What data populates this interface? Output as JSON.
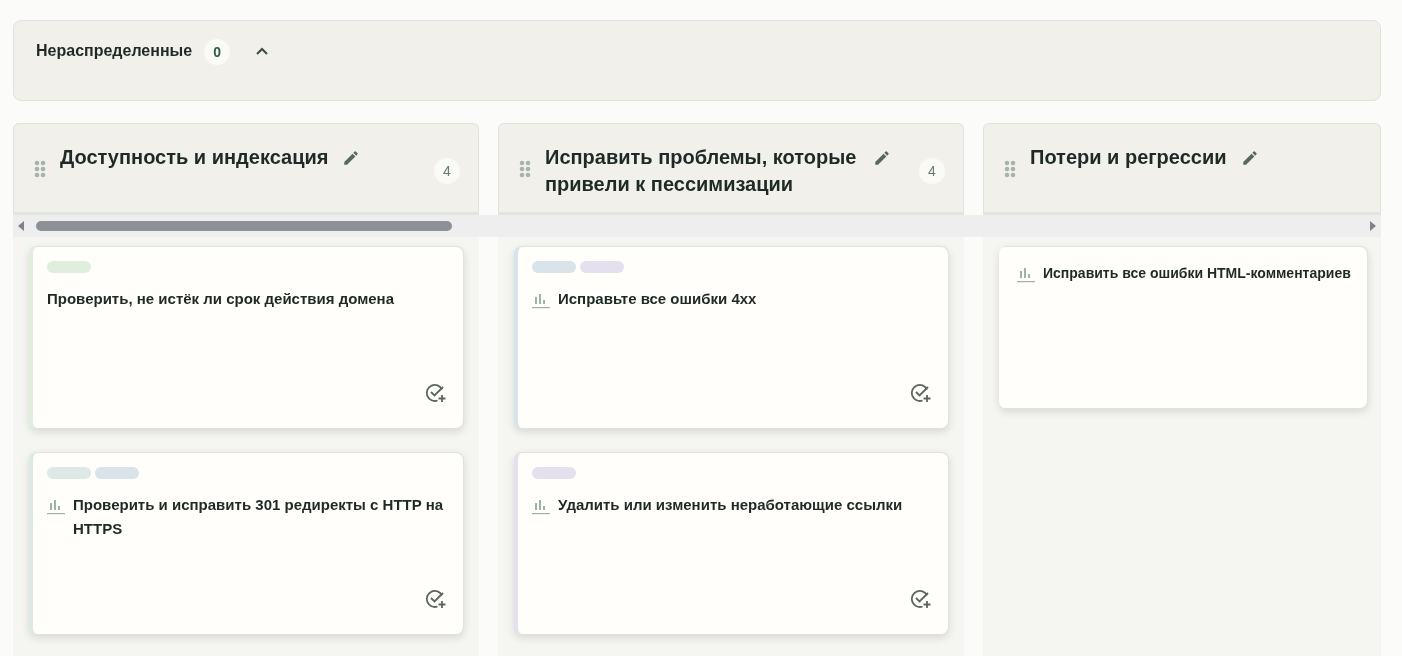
{
  "unassigned": {
    "title": "Нераспределенные",
    "count": "0",
    "expanded": true
  },
  "columns": [
    {
      "title": "Доступность и индексация",
      "count": "4",
      "cards": [
        {
          "tags": [
            {
              "color": "#dfeedd"
            }
          ],
          "metric": false,
          "title": "Проверить, не истёк ли срок действия домена",
          "action": true
        },
        {
          "tags": [
            {
              "color": "#dde9e7"
            },
            {
              "color": "#d8e4ea"
            }
          ],
          "metric": true,
          "title": "Проверить и исправить 301 редиректы с HTTP на HTTPS",
          "action": true
        }
      ]
    },
    {
      "title": "Исправить проблемы, которые привели к пессимизации",
      "count": "4",
      "cards": [
        {
          "tags": [
            {
              "color": "#d8e4ea"
            },
            {
              "color": "#e4e0ee"
            }
          ],
          "metric": true,
          "title": "Исправьте все ошибки 4xx",
          "action": true
        },
        {
          "tags": [
            {
              "color": "#e4e0ee"
            }
          ],
          "metric": true,
          "title": "Удалить или изменить неработающие ссылки",
          "action": true
        }
      ]
    },
    {
      "title": "Потери и регрессии",
      "cards": [
        {
          "metric": true,
          "title": "Исправить все ошибки HTML-комментариев",
          "action": false
        }
      ]
    }
  ]
}
